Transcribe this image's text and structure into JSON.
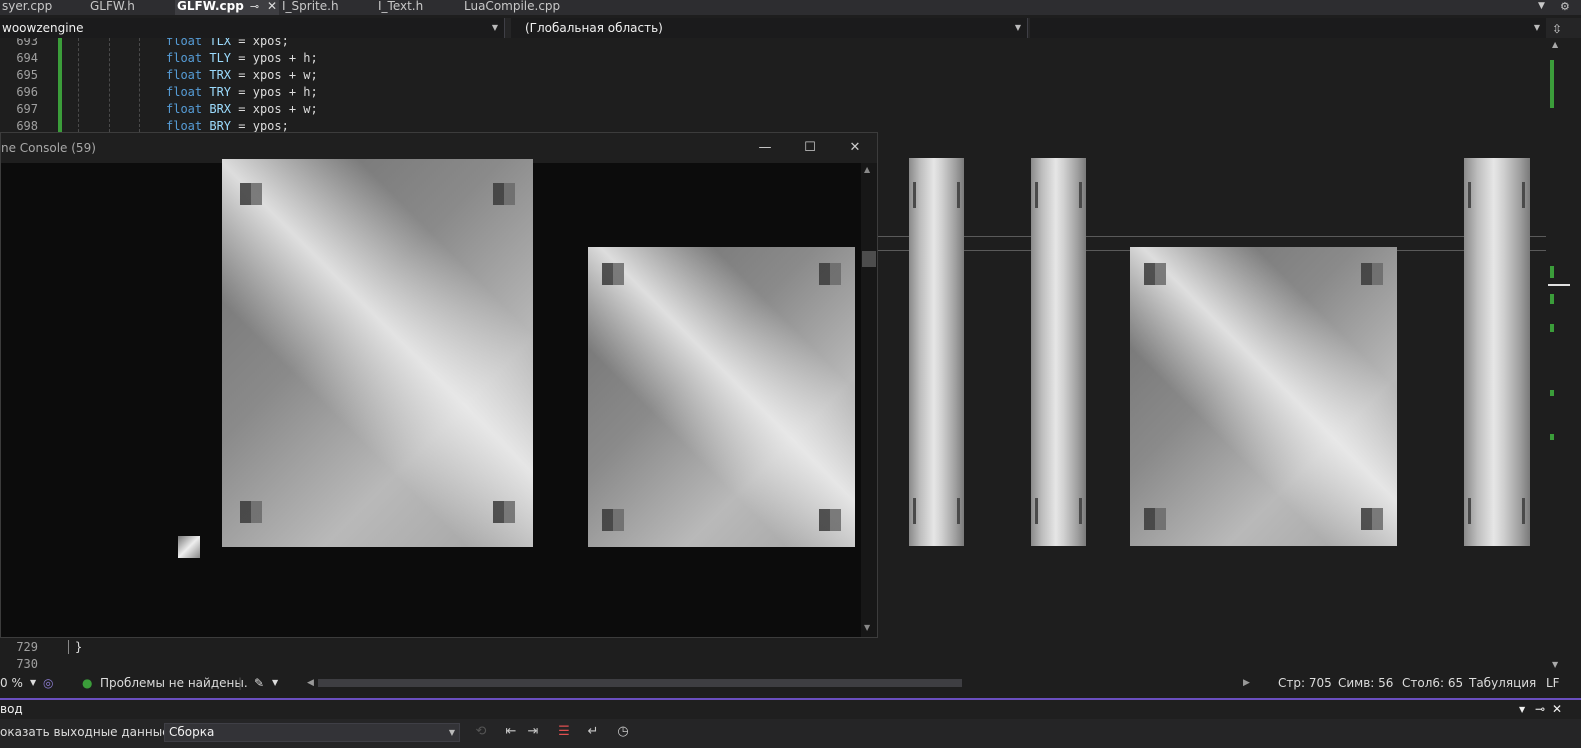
{
  "tabs": [
    {
      "label": "syer.cpp"
    },
    {
      "label": "GLFW.h"
    },
    {
      "label": "GLFW.cpp",
      "pin": "⊸",
      "close": "✕"
    },
    {
      "label": "I_Sprite.h"
    },
    {
      "label": "I_Text.h"
    },
    {
      "label": "LuaCompile.cpp"
    }
  ],
  "navbar": {
    "project": "woowzengine",
    "scope": "(Глобальная область)",
    "member": ""
  },
  "code": {
    "lines": [
      {
        "num": "693",
        "type": "float",
        "name": "TLX",
        "rest": " = xpos;"
      },
      {
        "num": "694",
        "type": "float",
        "name": "TLY",
        "rest": " = ypos + h;"
      },
      {
        "num": "695",
        "type": "float",
        "name": "TRX",
        "rest": " = xpos + w;"
      },
      {
        "num": "696",
        "type": "float",
        "name": "TRY",
        "rest": " = ypos + h;"
      },
      {
        "num": "697",
        "type": "float",
        "name": "BRX",
        "rest": " = xpos + w;"
      },
      {
        "num": "698",
        "type": "float",
        "name": "BRY",
        "rest": " = ypos;"
      }
    ],
    "bottom_lines": [
      {
        "num": "729",
        "text": "}"
      },
      {
        "num": "730",
        "text": ""
      }
    ]
  },
  "console": {
    "title": "ne Console (59)",
    "minimize": "—",
    "maximize": "☐",
    "close": "✕"
  },
  "status": {
    "zoom": "0 %",
    "issues": "Проблемы не найдены.",
    "line": "Стр: 705",
    "char": "Симв: 56",
    "col": "Стол6: 65",
    "indent": "Табуляция",
    "eol": "LF"
  },
  "output": {
    "title": "вод",
    "show_label": "оказать выходные данные из:",
    "source": "Сборка"
  },
  "colors": {
    "accent_purple": "#6a4fbf",
    "change_green": "#3b9d3a",
    "keyword": "#569cd6",
    "identifier": "#9cdcfe"
  },
  "icons": {
    "check": "check-circle-icon",
    "brush": "brush-icon",
    "pin": "pin-icon",
    "close": "close-icon"
  }
}
